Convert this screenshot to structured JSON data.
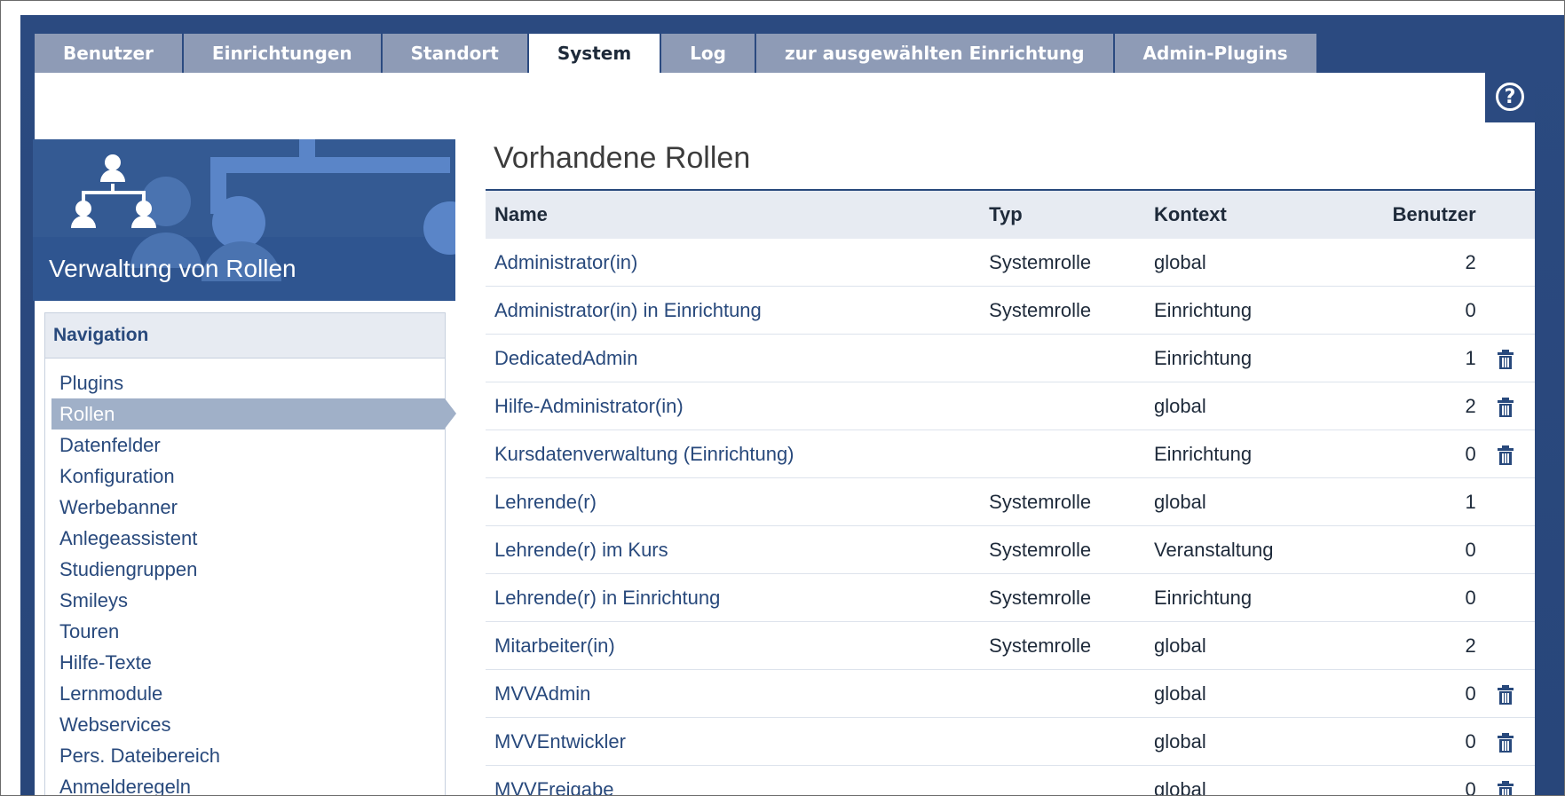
{
  "tabs": [
    {
      "label": "Benutzer",
      "active": false
    },
    {
      "label": "Einrichtungen",
      "active": false
    },
    {
      "label": "Standort",
      "active": false
    },
    {
      "label": "System",
      "active": true
    },
    {
      "label": "Log",
      "active": false
    },
    {
      "label": "zur ausgewählten Einrichtung",
      "active": false
    },
    {
      "label": "Admin-Plugins",
      "active": false
    }
  ],
  "help": {
    "icon": "help-icon",
    "glyph": "?"
  },
  "sidebar": {
    "title": "Verwaltung von Rollen",
    "nav_heading": "Navigation",
    "items": [
      {
        "label": "Plugins",
        "active": false
      },
      {
        "label": "Rollen",
        "active": true
      },
      {
        "label": "Datenfelder",
        "active": false
      },
      {
        "label": "Konfiguration",
        "active": false
      },
      {
        "label": "Werbebanner",
        "active": false
      },
      {
        "label": "Anlegeassistent",
        "active": false
      },
      {
        "label": "Studiengruppen",
        "active": false
      },
      {
        "label": "Smileys",
        "active": false
      },
      {
        "label": "Touren",
        "active": false
      },
      {
        "label": "Hilfe-Texte",
        "active": false
      },
      {
        "label": "Lernmodule",
        "active": false
      },
      {
        "label": "Webservices",
        "active": false
      },
      {
        "label": "Pers. Dateibereich",
        "active": false
      },
      {
        "label": "Anmelderegeln",
        "active": false
      }
    ]
  },
  "main": {
    "title": "Vorhandene Rollen",
    "columns": {
      "name": "Name",
      "typ": "Typ",
      "kontext": "Kontext",
      "benutzer": "Benutzer"
    },
    "rows": [
      {
        "name": "Administrator(in)",
        "typ": "Systemrolle",
        "kontext": "global",
        "benutzer": "2",
        "deletable": false
      },
      {
        "name": "Administrator(in) in Einrichtung",
        "typ": "Systemrolle",
        "kontext": "Einrichtung",
        "benutzer": "0",
        "deletable": false
      },
      {
        "name": "DedicatedAdmin",
        "typ": "",
        "kontext": "Einrichtung",
        "benutzer": "1",
        "deletable": true
      },
      {
        "name": "Hilfe-Administrator(in)",
        "typ": "",
        "kontext": "global",
        "benutzer": "2",
        "deletable": true
      },
      {
        "name": "Kursdatenverwaltung (Einrichtung)",
        "typ": "",
        "kontext": "Einrichtung",
        "benutzer": "0",
        "deletable": true
      },
      {
        "name": "Lehrende(r)",
        "typ": "Systemrolle",
        "kontext": "global",
        "benutzer": "1",
        "deletable": false
      },
      {
        "name": "Lehrende(r) im Kurs",
        "typ": "Systemrolle",
        "kontext": "Veranstaltung",
        "benutzer": "0",
        "deletable": false
      },
      {
        "name": "Lehrende(r) in Einrichtung",
        "typ": "Systemrolle",
        "kontext": "Einrichtung",
        "benutzer": "0",
        "deletable": false
      },
      {
        "name": "Mitarbeiter(in)",
        "typ": "Systemrolle",
        "kontext": "global",
        "benutzer": "2",
        "deletable": false
      },
      {
        "name": "MVVAdmin",
        "typ": "",
        "kontext": "global",
        "benutzer": "0",
        "deletable": true
      },
      {
        "name": "MVVEntwickler",
        "typ": "",
        "kontext": "global",
        "benutzer": "0",
        "deletable": true
      },
      {
        "name": "MVVFreigabe",
        "typ": "",
        "kontext": "global",
        "benutzer": "0",
        "deletable": true
      }
    ]
  },
  "colors": {
    "primary": "#28497c",
    "tab_inactive": "#8e9bb6",
    "active_nav": "#a0b0c8"
  }
}
